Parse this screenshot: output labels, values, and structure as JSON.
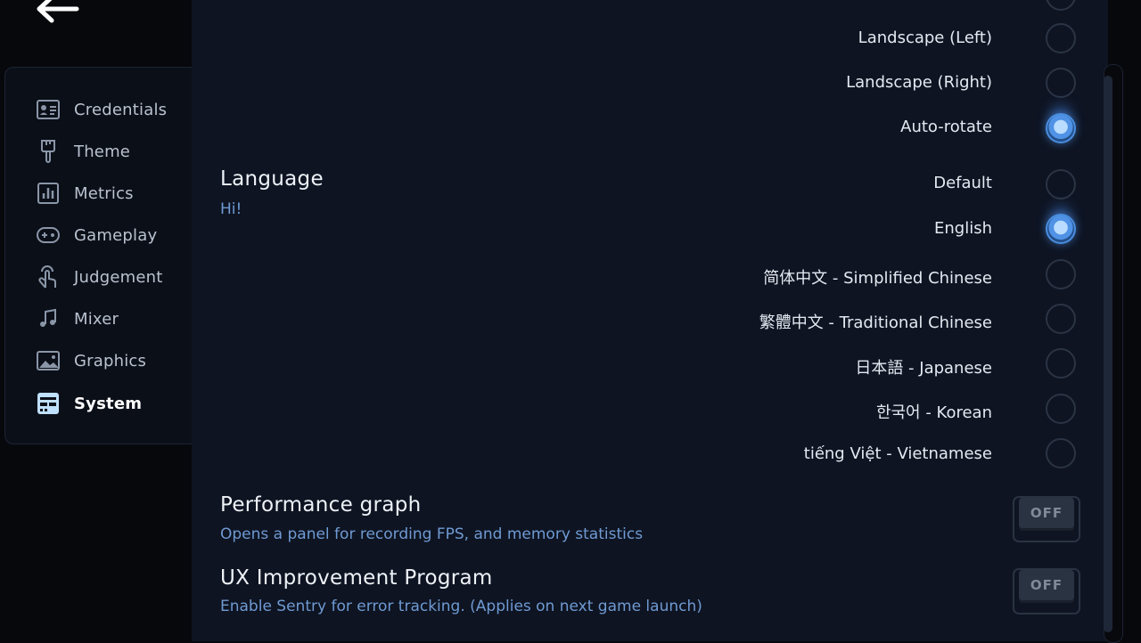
{
  "sidebar": {
    "items": [
      {
        "label": "Credentials",
        "icon": "id-card-icon"
      },
      {
        "label": "Theme",
        "icon": "paintbrush-icon"
      },
      {
        "label": "Metrics",
        "icon": "bar-chart-icon"
      },
      {
        "label": "Gameplay",
        "icon": "gamepad-icon"
      },
      {
        "label": "Judgement",
        "icon": "tap-hand-icon"
      },
      {
        "label": "Mixer",
        "icon": "music-note-icon"
      },
      {
        "label": "Graphics",
        "icon": "image-icon"
      },
      {
        "label": "System",
        "icon": "system-panel-icon",
        "active": true
      }
    ]
  },
  "orientation": {
    "options": [
      {
        "label": "Landscape (Left)",
        "selected": false
      },
      {
        "label": "Landscape (Right)",
        "selected": false
      },
      {
        "label": "Auto-rotate",
        "selected": true
      }
    ]
  },
  "language": {
    "title": "Language",
    "subtitle": "Hi!",
    "options": [
      {
        "label": "Default",
        "selected": false
      },
      {
        "label": "English",
        "selected": true
      },
      {
        "label": "简体中文 - Simplified Chinese",
        "selected": false
      },
      {
        "label": "繁體中文 - Traditional Chinese",
        "selected": false
      },
      {
        "label": "日本語 - Japanese",
        "selected": false
      },
      {
        "label": "한국어 - Korean",
        "selected": false
      },
      {
        "label": "tiếng Việt - Vietnamese",
        "selected": false
      }
    ]
  },
  "performance_graph": {
    "title": "Performance graph",
    "subtitle": "Opens a panel for recording FPS, and memory statistics",
    "toggle_label": "OFF"
  },
  "ux_program": {
    "title": "UX Improvement Program",
    "subtitle": "Enable Sentry for error tracking. (Applies on next game launch)",
    "toggle_label": "OFF"
  },
  "colors": {
    "accent": "#4f92e6",
    "subtitle": "#6f9ad2",
    "panel": "#0e1422",
    "background": "#06080c"
  }
}
